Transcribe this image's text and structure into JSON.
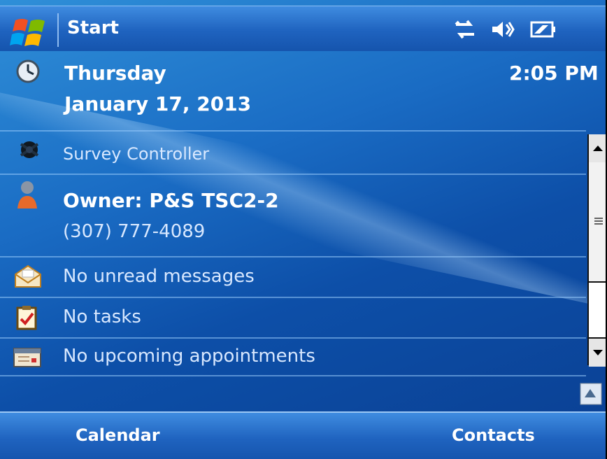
{
  "title_bar": {
    "title": "Start",
    "tray_icons": [
      "connectivity-icon",
      "volume-icon",
      "battery-icon"
    ]
  },
  "datetime": {
    "day": "Thursday",
    "date": "January 17, 2013",
    "time": "2:05 PM"
  },
  "items": {
    "survey_controller": "Survey Controller",
    "owner_name": "Owner: P&S TSC2-2",
    "owner_phone": "(307) 777-4089",
    "messages": "No unread messages",
    "tasks": "No tasks",
    "appointments": "No upcoming appointments"
  },
  "softkeys": {
    "left": "Calendar",
    "right": "Contacts"
  },
  "colors": {
    "background": "#1a6cc4",
    "bar": "#1f63bf",
    "text": "#ffffff"
  }
}
